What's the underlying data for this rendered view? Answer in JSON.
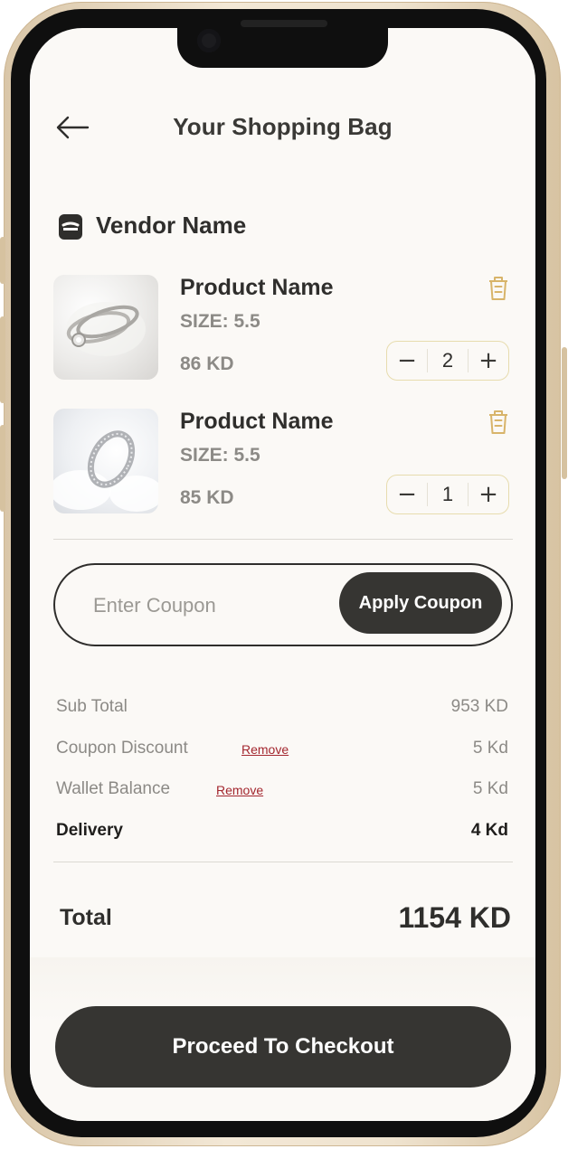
{
  "header": {
    "title": "Your Shopping Bag",
    "back_icon": "arrow-left-icon"
  },
  "vendor": {
    "name": "Vendor Name",
    "icon": "shop-icon"
  },
  "products": [
    {
      "name": "Product Name",
      "size": "SIZE: 5.5",
      "price": "86 KD",
      "quantity": "2",
      "image": "ring-image"
    },
    {
      "name": "Product Name",
      "size": "SIZE: 5.5",
      "price": "85 KD",
      "quantity": "1",
      "image": "ring-image"
    }
  ],
  "stepper": {
    "minus": "−",
    "plus": "+"
  },
  "coupon": {
    "placeholder": "Enter Coupon",
    "value": "",
    "apply_label": "Apply Coupon"
  },
  "summary": {
    "subtotal_label": "Sub Total",
    "subtotal_value": "953 KD",
    "coupon_label": "Coupon Discount",
    "coupon_remove": "Remove",
    "coupon_value": "5 Kd",
    "wallet_label": "Wallet Balance",
    "wallet_remove": "Remove",
    "wallet_value": "5 Kd",
    "delivery_label": "Delivery",
    "delivery_value": "4 Kd"
  },
  "total": {
    "label": "Total",
    "value": "1154 KD"
  },
  "checkout": {
    "label": "Proceed To Checkout"
  },
  "colors": {
    "accent_gold": "#d8b46a",
    "dark_button": "#363532",
    "remove_red": "#a3262e",
    "screen_bg": "#fbf9f6"
  }
}
